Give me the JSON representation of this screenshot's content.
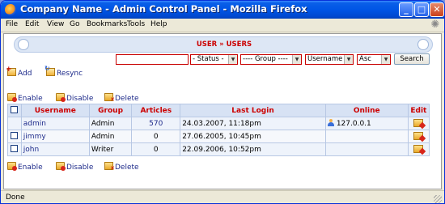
{
  "window": {
    "title": "Company Name - Admin Control Panel - Mozilla Firefox"
  },
  "title_buttons": {
    "minimize": "_",
    "maximize": "□",
    "close": "✕"
  },
  "menu": [
    "File",
    "Edit",
    "View",
    "Go",
    "Bookmarks",
    "Tools",
    "Help"
  ],
  "breadcrumb": "USER » USERS",
  "filters": {
    "search_value": "",
    "status": "- Status -",
    "group": "---- Group ----",
    "order_by": "Username",
    "direction": "Asc",
    "search_button": "Search"
  },
  "top_actions": {
    "add": "Add",
    "resync": "Resync"
  },
  "bulk_actions": {
    "enable": "Enable",
    "disable": "Disable",
    "delete": "Delete"
  },
  "table": {
    "headers": [
      "Username",
      "Group",
      "Articles",
      "Last Login",
      "Online",
      "Edit"
    ],
    "rows": [
      {
        "username": "admin",
        "group": "Admin",
        "articles": "570",
        "last_login": "24.03.2007, 11:18pm",
        "online": "127.0.0.1"
      },
      {
        "username": "jimmy",
        "group": "Admin",
        "articles": "0",
        "last_login": "27.06.2005, 10:45pm",
        "online": ""
      },
      {
        "username": "john",
        "group": "Writer",
        "articles": "0",
        "last_login": "22.09.2006, 10:52pm",
        "online": ""
      }
    ]
  },
  "status": "Done",
  "colors": {
    "accent": "#cc0000",
    "link": "#1d2a8a",
    "header_bg": "#d7e2f4",
    "titlebar": "#0055e5"
  }
}
